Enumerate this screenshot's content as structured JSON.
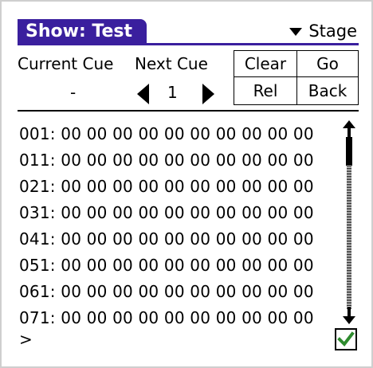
{
  "title": "Show: Test",
  "category": "Stage",
  "cues": {
    "current_label": "Current Cue",
    "next_label": "Next Cue",
    "current_value": "-",
    "next_value": "1"
  },
  "buttons": {
    "clear": "Clear",
    "go": "Go",
    "rel": "Rel",
    "back": "Back"
  },
  "channels": [
    "001: 00 00 00 00 00 00 00 00 00 00",
    "011: 00 00 00 00 00 00 00 00 00 00",
    "021: 00 00 00 00 00 00 00 00 00 00",
    "031: 00 00 00 00 00 00 00 00 00 00",
    "041: 00 00 00 00 00 00 00 00 00 00",
    "051: 00 00 00 00 00 00 00 00 00 00",
    "061: 00 00 00 00 00 00 00 00 00 00",
    "071: 00 00 00 00 00 00 00 00 00 00"
  ],
  "prompt": ">",
  "colors": {
    "title_bar": "#3a1f9e",
    "check": "#2e8b2e"
  },
  "icons": {
    "category": "dropdown-triangle-icon",
    "prev": "left-arrow-icon",
    "next": "right-arrow-icon",
    "check": "checkmark-icon"
  }
}
